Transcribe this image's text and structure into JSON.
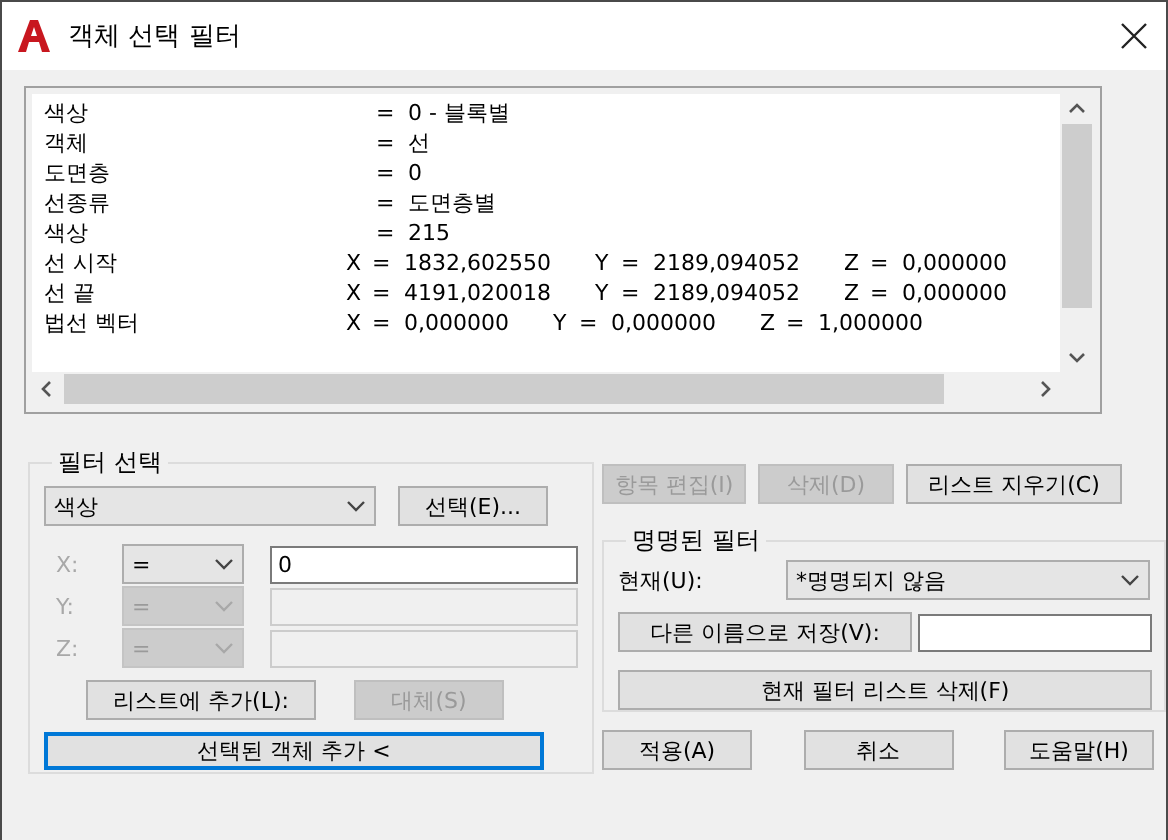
{
  "window": {
    "title": "객체 선택 필터"
  },
  "filter_list": {
    "rows": [
      {
        "kind": "property",
        "name": "색상",
        "operator": "=",
        "value": "0 - 블록별"
      },
      {
        "kind": "property",
        "name": "객체",
        "operator": "=",
        "value": "선"
      },
      {
        "kind": "property",
        "name": "도면층",
        "operator": "=",
        "value": "0"
      },
      {
        "kind": "property",
        "name": "선종류",
        "operator": "=",
        "value": "도면층별"
      },
      {
        "kind": "property",
        "name": "색상",
        "operator": "=",
        "value": "215"
      },
      {
        "kind": "vector",
        "name": "선 시작",
        "components": [
          {
            "axis": "X",
            "operator": "=",
            "value": "1832,602550"
          },
          {
            "axis": "Y",
            "operator": "=",
            "value": "2189,094052"
          },
          {
            "axis": "Z",
            "operator": "=",
            "value": "0,000000"
          }
        ]
      },
      {
        "kind": "vector",
        "name": "선 끝",
        "components": [
          {
            "axis": "X",
            "operator": "=",
            "value": "4191,020018"
          },
          {
            "axis": "Y",
            "operator": "=",
            "value": "2189,094052"
          },
          {
            "axis": "Z",
            "operator": "=",
            "value": "0,000000"
          }
        ]
      },
      {
        "kind": "vector",
        "name": "법선 벡터",
        "components": [
          {
            "axis": "X",
            "operator": "=",
            "value": "0,000000"
          },
          {
            "axis": "Y",
            "operator": "=",
            "value": "0,000000"
          },
          {
            "axis": "Z",
            "operator": "=",
            "value": "1,000000"
          }
        ]
      }
    ]
  },
  "filter_select": {
    "label": "필터 선택",
    "property": "색상",
    "select_button": "선택(E)...",
    "axes": [
      {
        "label": "X:",
        "operator": "=",
        "value": "0",
        "disabled": false
      },
      {
        "label": "Y:",
        "operator": "=",
        "disabled": true
      },
      {
        "label": "Z:",
        "operator": "=",
        "disabled": true
      }
    ],
    "add_button": {
      "label": "리스트에 추가(L):",
      "disabled": false
    },
    "replace_button": {
      "label": "대체(S)",
      "disabled": true
    },
    "add_selected_button": {
      "label": "선택된 객체 추가 <",
      "focused": true
    }
  },
  "list_buttons": [
    {
      "label": "항목 편집(I)",
      "disabled": true
    },
    {
      "label": "삭제(D)",
      "disabled": true
    },
    {
      "label": "리스트 지우기(C)",
      "disabled": false
    }
  ],
  "named_filters": {
    "label": "명명된 필터",
    "current_label": "현재(U):",
    "current": "*명명되지 않음",
    "save_as_button": "다른 이름으로 저장(V):",
    "delete_button": "현재 필터 리스트 삭제(F)"
  },
  "buttons": [
    "적용(A)",
    "취소",
    "도움말(H)"
  ]
}
